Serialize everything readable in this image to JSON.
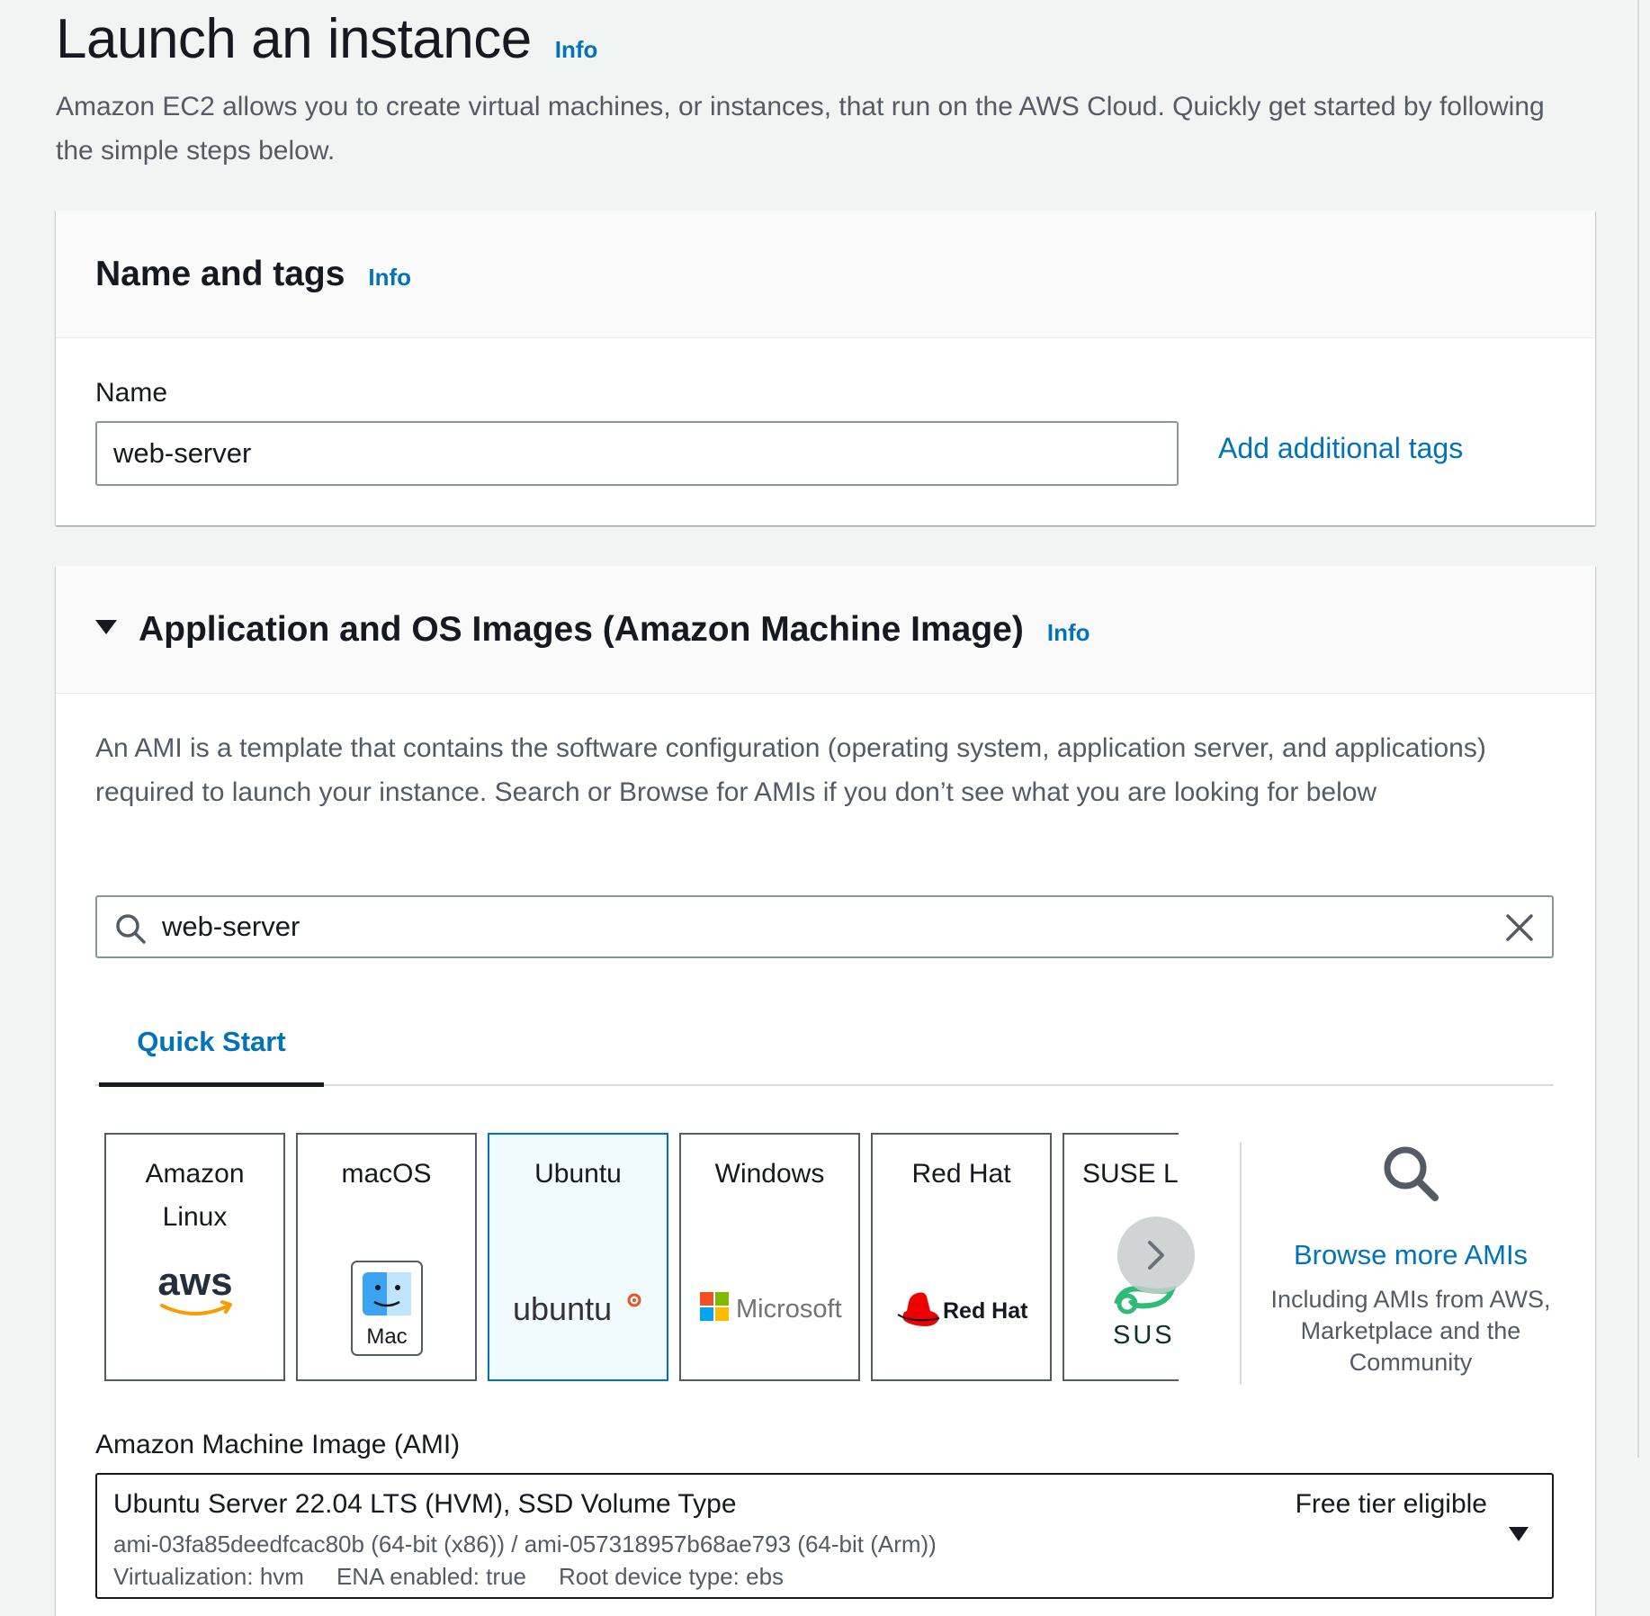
{
  "header": {
    "title": "Launch an instance",
    "info": "Info",
    "description": "Amazon EC2 allows you to create virtual machines, or instances, that run on the AWS Cloud. Quickly get started by following the simple steps below."
  },
  "name_tags": {
    "title": "Name and tags",
    "info": "Info",
    "name_label": "Name",
    "name_value": "web-server",
    "add_tags": "Add additional tags"
  },
  "ami_section": {
    "title": "Application and OS Images (Amazon Machine Image)",
    "info": "Info",
    "description": "An AMI is a template that contains the software configuration (operating system, application server, and applications) required to launch your instance. Search or Browse for AMIs if you don’t see what you are looking for below",
    "search_value": "web-server",
    "tab_quick_start": "Quick Start",
    "tiles": [
      {
        "label": "Amazon Linux",
        "logo_text": "aws",
        "icon": "aws-logo"
      },
      {
        "label": "macOS",
        "logo_text": "Mac",
        "icon": "mac-finder-logo"
      },
      {
        "label": "Ubuntu",
        "logo_text": "ubuntu",
        "icon": "ubuntu-logo",
        "selected": true
      },
      {
        "label": "Windows",
        "logo_text": "Microsoft",
        "icon": "microsoft-logo"
      },
      {
        "label": "Red Hat",
        "logo_text": "Red Hat",
        "icon": "redhat-logo"
      },
      {
        "label": "SUSE Li",
        "logo_text": "SUS",
        "icon": "suse-logo"
      }
    ],
    "browse_title": "Browse more AMIs",
    "browse_subtitle": "Including AMIs from AWS, Marketplace and the Community",
    "ami_label": "Amazon Machine Image (AMI)",
    "ami_selected": {
      "name": "Ubuntu Server 22.04 LTS (HVM), SSD Volume Type",
      "badge": "Free tier eligible",
      "ids": "ami-03fa85deedfcac80b (64-bit (x86)) / ami-057318957b68ae793 (64-bit (Arm))",
      "virtualization": "Virtualization: hvm",
      "ena": "ENA enabled: true",
      "root_device": "Root device type: ebs"
    }
  },
  "colors": {
    "link": "#0073bb",
    "background": "#f2f3f3",
    "text": "#16191f",
    "secondary_text": "#545b64",
    "selected_tile_bg": "#f1faff"
  }
}
